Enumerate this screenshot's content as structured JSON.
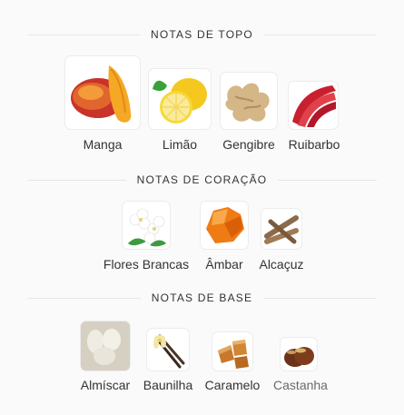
{
  "sections": [
    {
      "title": "NOTAS DE TOPO",
      "items": [
        {
          "label": "Manga",
          "icon": "mango-icon"
        },
        {
          "label": "Limão",
          "icon": "lemon-icon"
        },
        {
          "label": "Gengibre",
          "icon": "ginger-icon"
        },
        {
          "label": "Ruibarbo",
          "icon": "rhubarb-icon"
        }
      ]
    },
    {
      "title": "NOTAS DE CORAÇÃO",
      "items": [
        {
          "label": "Flores Brancas",
          "icon": "white-flowers-icon"
        },
        {
          "label": "Âmbar",
          "icon": "amber-icon"
        },
        {
          "label": "Alcaçuz",
          "icon": "licorice-icon"
        }
      ]
    },
    {
      "title": "NOTAS DE BASE",
      "items": [
        {
          "label": "Almíscar",
          "icon": "musk-icon"
        },
        {
          "label": "Baunilha",
          "icon": "vanilla-icon"
        },
        {
          "label": "Caramelo",
          "icon": "caramel-icon"
        },
        {
          "label": "Castanha",
          "icon": "chestnut-icon"
        }
      ]
    }
  ]
}
